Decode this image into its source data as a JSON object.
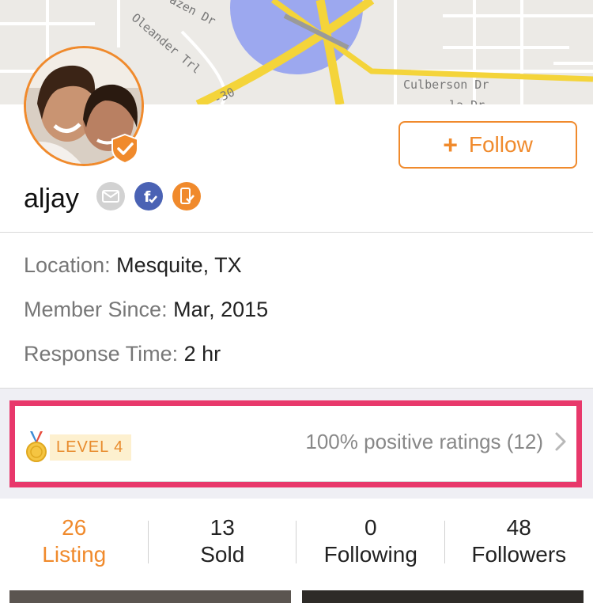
{
  "map": {
    "streets": [
      "azen Dr",
      "Oleander Trl",
      "Culberson Dr",
      "-30",
      "la Dr"
    ]
  },
  "profile": {
    "username": "aljay",
    "follow_label": "Follow",
    "badges": [
      "email-verified",
      "facebook-verified",
      "phone-verified"
    ]
  },
  "info": {
    "location_key": "Location:",
    "location_value": "Mesquite, TX",
    "member_key": "Member Since:",
    "member_value": "Mar, 2015",
    "response_key": "Response Time:",
    "response_value": "2 hr"
  },
  "rating": {
    "level": "LEVEL 4",
    "text": "100% positive ratings (12)"
  },
  "stats": [
    {
      "num": "26",
      "label": "Listing"
    },
    {
      "num": "13",
      "label": "Sold"
    },
    {
      "num": "0",
      "label": "Following"
    },
    {
      "num": "48",
      "label": "Followers"
    }
  ],
  "colors": {
    "accent": "#f08a2c",
    "highlight": "#e8386b"
  }
}
